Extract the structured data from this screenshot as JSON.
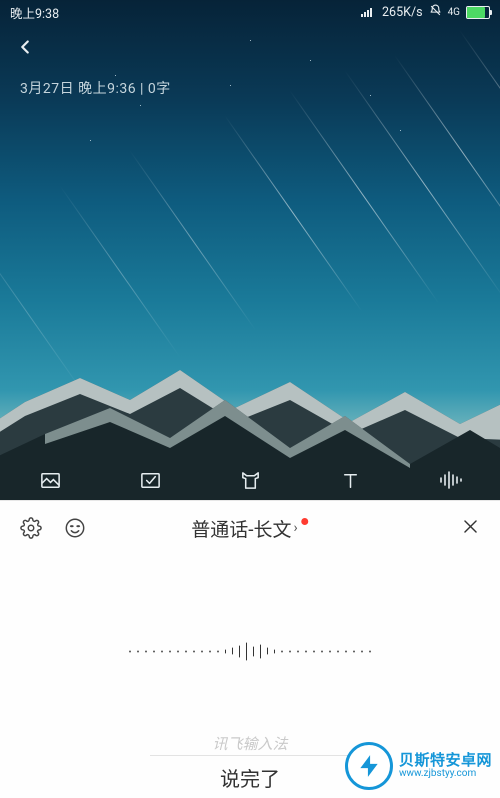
{
  "status": {
    "time": "晚上9:38",
    "net_speed": "265K/s",
    "net_label": "4G",
    "battery_glyph": "▮"
  },
  "note": {
    "meta": "3月27日 晚上9:36 | 0字"
  },
  "toolbar": {
    "image": "image-icon",
    "check": "checkbox-icon",
    "theme": "shirt-icon",
    "text": "text-format-icon",
    "voice": "voice-waveform-icon"
  },
  "ime": {
    "gear": "settings-icon",
    "emoji": "emoji-icon",
    "language": "普通话-长文",
    "chevron": "›",
    "close": "close-icon",
    "hint": "讯飞输入法",
    "done": "说完了"
  },
  "watermark": {
    "brand_cn": "贝斯特安卓网",
    "brand_en": "www.zjbstyy.com"
  }
}
